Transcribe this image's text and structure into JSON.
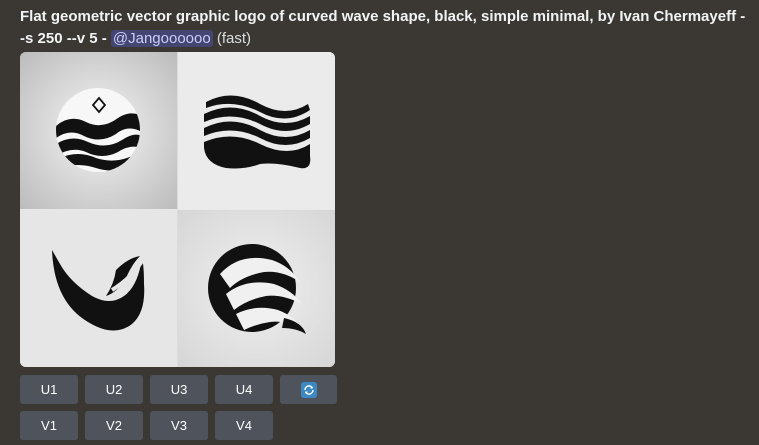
{
  "message": {
    "prompt": "Flat geometric vector graphic logo of curved wave shape, black, simple minimal, by Ivan Chermayeff --s 250 --v 5",
    "separator": " - ",
    "mention": "@Jangoooooo",
    "speed": "(fast)"
  },
  "image": {
    "alt": "Grid of four generated wave logo images",
    "quadrant_names": [
      "wave-circle-logo",
      "wave-stripes-logo",
      "wave-u-logo",
      "wave-swirl-logo"
    ]
  },
  "buttons": {
    "upscale": [
      "U1",
      "U2",
      "U3",
      "U4"
    ],
    "variation": [
      "V1",
      "V2",
      "V3",
      "V4"
    ],
    "reroll_icon": "refresh-icon"
  },
  "colors": {
    "background": "#3b3733",
    "button": "#4f545c",
    "mention_bg": "#5865f2",
    "reroll_icon": "#3b88c3"
  }
}
